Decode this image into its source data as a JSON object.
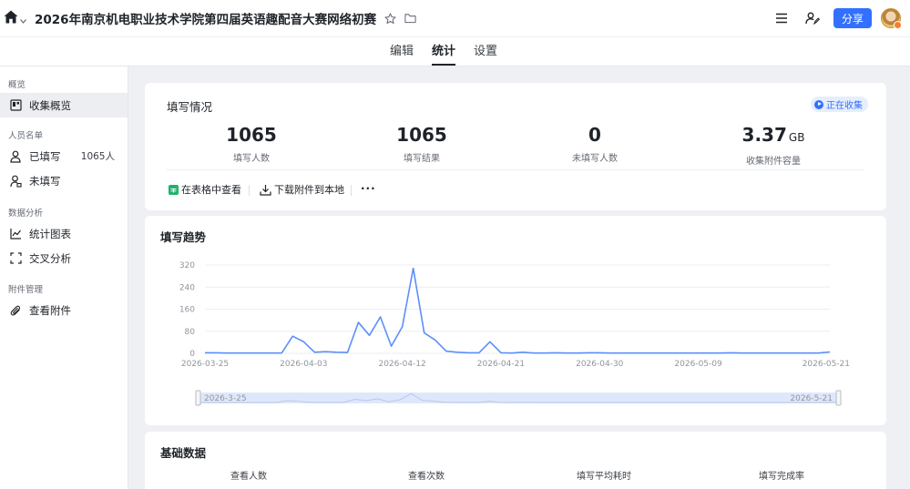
{
  "header": {
    "title": "2026年南京机电职业技术学院第四届英语趣配音大赛网络初赛",
    "share_label": "分享"
  },
  "tabs": [
    {
      "label": "编辑",
      "active": false
    },
    {
      "label": "统计",
      "active": true
    },
    {
      "label": "设置",
      "active": false
    }
  ],
  "sidebar": {
    "sections": [
      {
        "label": "概览"
      },
      {
        "label": "人员名单"
      },
      {
        "label": "数据分析"
      },
      {
        "label": "附件管理"
      }
    ],
    "items": [
      {
        "label": "收集概览",
        "icon": "dashboard-icon",
        "active": true
      },
      {
        "label": "已填写",
        "count": "1065人",
        "icon": "user-check-icon"
      },
      {
        "label": "未填写",
        "icon": "user-pending-icon"
      },
      {
        "label": "统计图表",
        "icon": "line-chart-icon"
      },
      {
        "label": "交叉分析",
        "icon": "cross-analysis-icon"
      },
      {
        "label": "查看附件",
        "icon": "paperclip-icon"
      }
    ]
  },
  "overview": {
    "title": "填写情况",
    "status": "正在收集",
    "stats": [
      {
        "value": "1065",
        "unit": "",
        "label": "填写人数"
      },
      {
        "value": "1065",
        "unit": "",
        "label": "填写结果"
      },
      {
        "value": "0",
        "unit": "",
        "label": "未填写人数"
      },
      {
        "value": "3.37",
        "unit": "GB",
        "label": "收集附件容量"
      }
    ],
    "actions": {
      "view_table": "在表格中查看",
      "download": "下载附件到本地",
      "more": "···"
    }
  },
  "trend": {
    "title": "填写趋势",
    "range_start": "2026-3-25",
    "range_end": "2026-5-21"
  },
  "chart_data": {
    "type": "line",
    "title": "填写趋势",
    "xlabel": "",
    "ylabel": "",
    "ylim": [
      0,
      320
    ],
    "y_ticks": [
      0,
      80,
      160,
      240,
      320
    ],
    "x_tick_labels": [
      "2026-03-25",
      "2026-04-03",
      "2026-04-12",
      "2026-04-21",
      "2026-04-30",
      "2026-05-09",
      "2026-05-21"
    ],
    "grid": true,
    "series": [
      {
        "color": "#5b8ff9",
        "x": [
          "2026-03-25",
          "2026-03-26",
          "2026-03-27",
          "2026-03-28",
          "2026-03-29",
          "2026-03-30",
          "2026-03-31",
          "2026-04-01",
          "2026-04-02",
          "2026-04-03",
          "2026-04-04",
          "2026-04-05",
          "2026-04-06",
          "2026-04-07",
          "2026-04-08",
          "2026-04-09",
          "2026-04-10",
          "2026-04-11",
          "2026-04-12",
          "2026-04-13",
          "2026-04-14",
          "2026-04-15",
          "2026-04-16",
          "2026-04-17",
          "2026-04-18",
          "2026-04-19",
          "2026-04-20",
          "2026-04-21",
          "2026-04-22",
          "2026-04-23",
          "2026-04-24",
          "2026-04-25",
          "2026-04-26",
          "2026-04-27",
          "2026-04-28",
          "2026-04-29",
          "2026-04-30",
          "2026-05-01",
          "2026-05-02",
          "2026-05-03",
          "2026-05-04",
          "2026-05-05",
          "2026-05-06",
          "2026-05-07",
          "2026-05-08",
          "2026-05-09",
          "2026-05-10",
          "2026-05-11",
          "2026-05-12",
          "2026-05-13",
          "2026-05-14",
          "2026-05-15",
          "2026-05-16",
          "2026-05-17",
          "2026-05-18",
          "2026-05-19",
          "2026-05-20",
          "2026-05-21"
        ],
        "values": [
          2,
          2,
          1,
          1,
          1,
          1,
          1,
          1,
          62,
          42,
          4,
          6,
          4,
          3,
          112,
          65,
          132,
          26,
          96,
          308,
          74,
          48,
          8,
          4,
          2,
          2,
          42,
          2,
          1,
          4,
          1,
          1,
          2,
          1,
          1,
          2,
          2,
          1,
          1,
          1,
          1,
          1,
          1,
          1,
          1,
          1,
          1,
          1,
          2,
          1,
          1,
          1,
          1,
          1,
          1,
          1,
          1,
          5
        ]
      }
    ]
  },
  "basic": {
    "title": "基础数据",
    "headers": [
      "查看人数",
      "查看次数",
      "填写平均耗时",
      "填写完成率"
    ]
  }
}
